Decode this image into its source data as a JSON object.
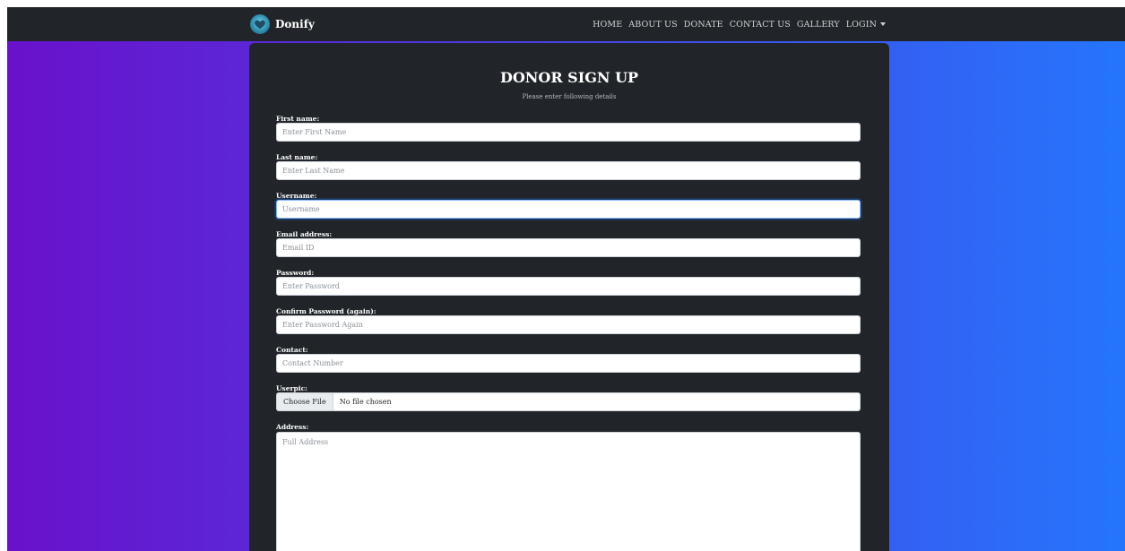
{
  "navbar": {
    "brand": "Donify",
    "links": [
      "HOME",
      "ABOUT US",
      "DONATE",
      "CONTACT US",
      "GALLERY",
      "LOGIN"
    ]
  },
  "form": {
    "title": "DONOR SIGN UP",
    "subtitle": "Please enter following details",
    "fields": {
      "first_name": {
        "label": "First name:",
        "placeholder": "Enter First Name"
      },
      "last_name": {
        "label": "Last name:",
        "placeholder": "Enter Last Name"
      },
      "username": {
        "label": "Username:",
        "placeholder": "Username"
      },
      "email": {
        "label": "Email address:",
        "placeholder": "Email ID"
      },
      "password": {
        "label": "Password:",
        "placeholder": "Enter Password"
      },
      "confirm_password": {
        "label": "Confirm Password (again):",
        "placeholder": "Enter Password Again"
      },
      "contact": {
        "label": "Contact:",
        "placeholder": "Contact Number"
      },
      "userpic": {
        "label": "Userpic:",
        "button": "Choose File",
        "status": "No file chosen"
      },
      "address": {
        "label": "Address:",
        "placeholder": "Full Address"
      }
    }
  },
  "colors": {
    "navbar_bg": "#212529",
    "card_bg": "#212529",
    "gradient_start": "#6a11cb",
    "gradient_end": "#2575fc"
  }
}
